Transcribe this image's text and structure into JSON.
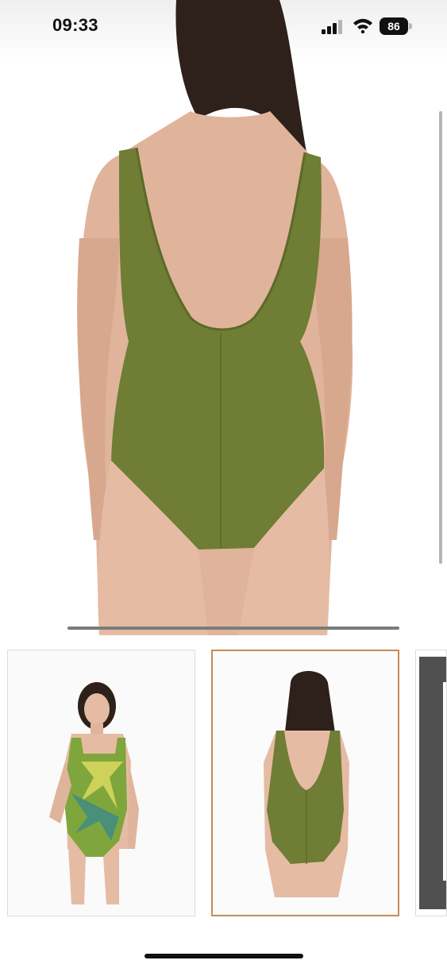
{
  "status_bar": {
    "time": "09:33",
    "battery_level": "86",
    "icons": [
      "signal-icon",
      "wifi-icon",
      "battery-icon"
    ]
  },
  "product_gallery": {
    "main_image": "product-photo-back-view",
    "thumbnails": [
      {
        "name": "front-view",
        "selected": false
      },
      {
        "name": "back-view",
        "selected": true
      },
      {
        "name": "partial-third-image",
        "selected": false
      }
    ],
    "colors": {
      "swimsuit": "#6f7d35",
      "selected_border": "#c98a55",
      "skin": "#e0b49b",
      "hair": "#2e201a"
    }
  }
}
